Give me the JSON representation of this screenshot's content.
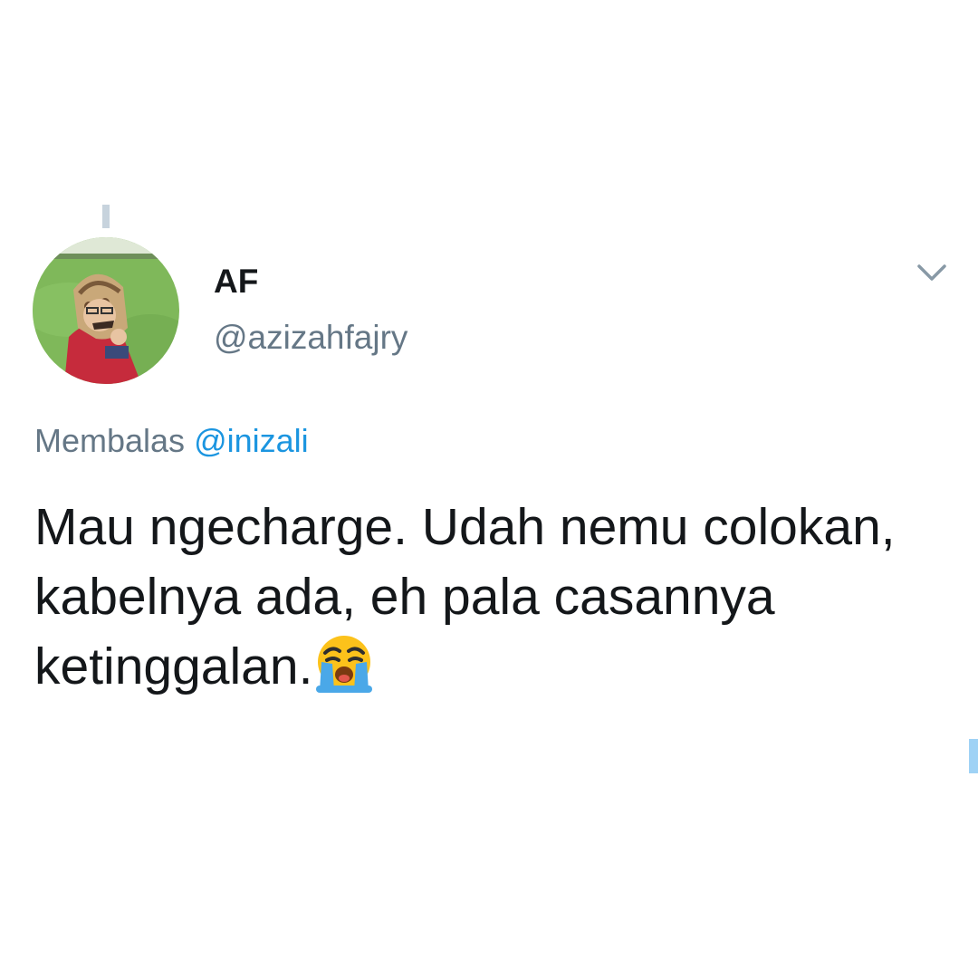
{
  "tweet": {
    "author": {
      "display_name": "AF",
      "handle": "@azizahfajry"
    },
    "reply_context": {
      "prefix": "Membalas",
      "handle": "@inizali"
    },
    "text": "Mau ngecharge. Udah nemu colokan, kabelnya ada, eh pala casannya ketinggalan.",
    "emoji": "loudly-crying-face"
  },
  "icons": {
    "menu": "chevron-down-icon"
  },
  "colors": {
    "text": "#14171a",
    "secondary": "#657786",
    "link": "#1b95e0"
  }
}
